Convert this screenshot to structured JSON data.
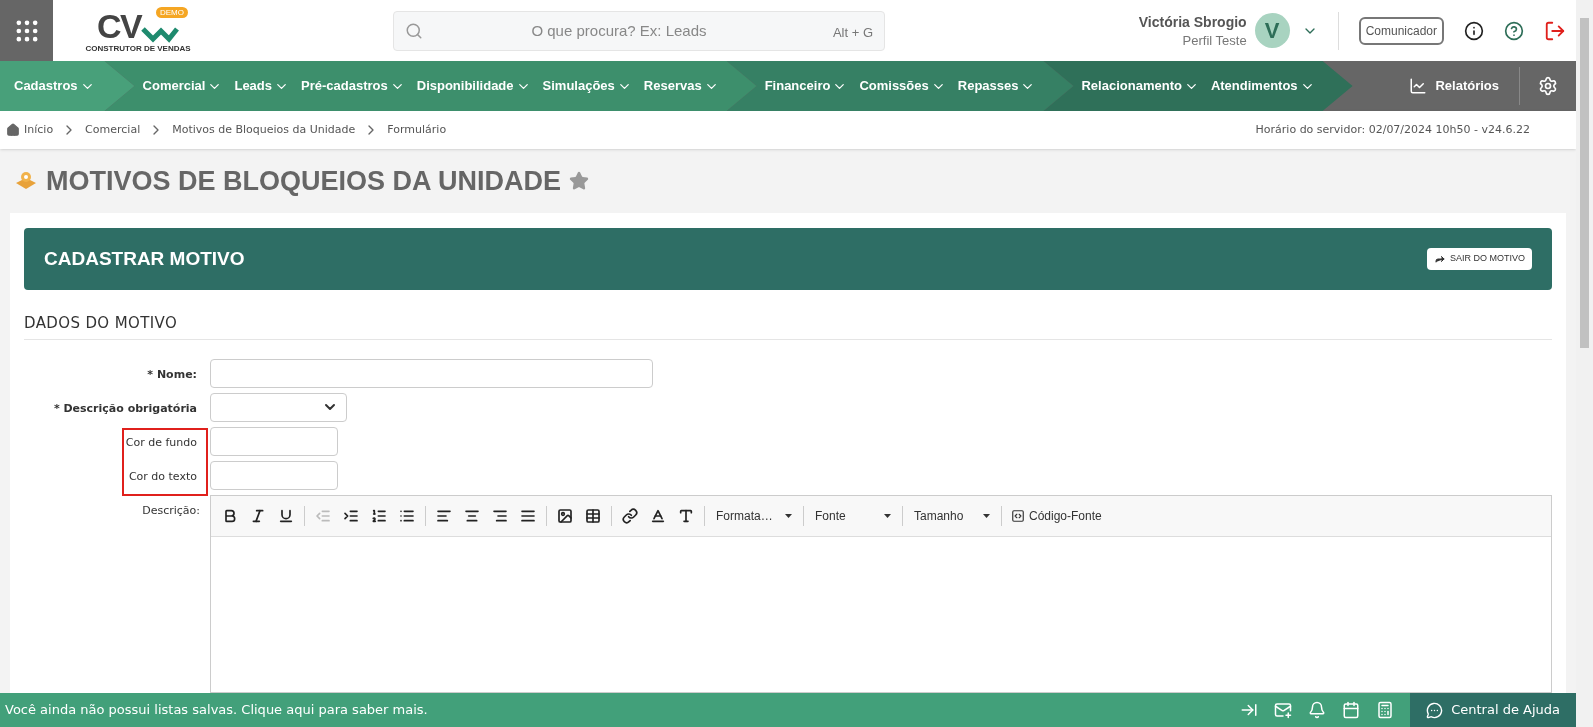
{
  "header": {
    "logo_text": "CV",
    "logo_badge": "DEMO",
    "logo_caption": "CONSTRUTOR DE VENDAS",
    "search": {
      "placeholder": "O que procura? Ex: Leads",
      "shortcut": "Alt + G"
    },
    "user": {
      "name": "Victória Sbrogio",
      "profile": "Perfil Teste",
      "initial": "V"
    },
    "communicator": "Comunicador"
  },
  "nav": {
    "groups": [
      {
        "items": [
          "Cadastros"
        ]
      },
      {
        "items": [
          "Comercial",
          "Leads",
          "Pré-cadastros",
          "Disponibilidade",
          "Simulações",
          "Reservas"
        ]
      },
      {
        "items": [
          "Financeiro",
          "Comissões",
          "Repasses"
        ]
      },
      {
        "items": [
          "Relacionamento",
          "Atendimentos"
        ]
      }
    ],
    "reports": "Relatórios"
  },
  "breadcrumb": {
    "items": [
      "Início",
      "Comercial",
      "Motivos de Bloqueios da Unidade",
      "Formulário"
    ],
    "server_time": "Horário do servidor: 02/07/2024 10h50 - v24.6.22"
  },
  "page_title": "MOTIVOS DE BLOQUEIOS DA UNIDADE",
  "form": {
    "title": "CADASTRAR MOTIVO",
    "exit_button": "SAIR DO MOTIVO",
    "section": "DADOS DO MOTIVO",
    "fields": [
      {
        "kind": "text",
        "label": "* Nome:",
        "bold": true,
        "highlighted": false
      },
      {
        "kind": "select",
        "label": "* Descrição obrigatória",
        "bold": true,
        "highlighted": false
      },
      {
        "kind": "text",
        "label": "Cor de fundo",
        "bold": false,
        "highlighted": true
      },
      {
        "kind": "text",
        "label": "Cor do texto",
        "bold": false,
        "highlighted": true
      }
    ],
    "editor": {
      "label": "Descrição:",
      "toolbar": [
        {
          "kind": "icon",
          "disabled": false
        },
        {
          "kind": "icon",
          "disabled": false
        },
        {
          "kind": "icon",
          "disabled": false
        },
        {
          "kind": "separator"
        },
        {
          "kind": "icon",
          "disabled": true
        },
        {
          "kind": "icon",
          "disabled": false
        },
        {
          "kind": "icon",
          "disabled": false
        },
        {
          "kind": "icon",
          "disabled": false
        },
        {
          "kind": "separator"
        },
        {
          "kind": "icon",
          "disabled": false
        },
        {
          "kind": "icon",
          "disabled": false
        },
        {
          "kind": "icon",
          "disabled": false
        },
        {
          "kind": "icon",
          "disabled": false
        },
        {
          "kind": "separator"
        },
        {
          "kind": "icon",
          "disabled": false
        },
        {
          "kind": "icon",
          "disabled": false
        },
        {
          "kind": "separator"
        },
        {
          "kind": "icon",
          "disabled": false
        },
        {
          "kind": "icon",
          "disabled": false
        },
        {
          "kind": "icon",
          "disabled": false
        },
        {
          "kind": "separator"
        },
        {
          "kind": "dropdown",
          "label": "Formata…"
        },
        {
          "kind": "separator"
        },
        {
          "kind": "dropdown",
          "label": "Fonte"
        },
        {
          "kind": "separator"
        },
        {
          "kind": "dropdown",
          "label": "Tamanho"
        },
        {
          "kind": "separator"
        },
        {
          "kind": "source",
          "label": "Código-Fonte"
        }
      ]
    }
  },
  "footer": {
    "message": "Você ainda não possui listas salvas. Clique aqui para saber mais.",
    "help": "Central de Ajuda"
  }
}
